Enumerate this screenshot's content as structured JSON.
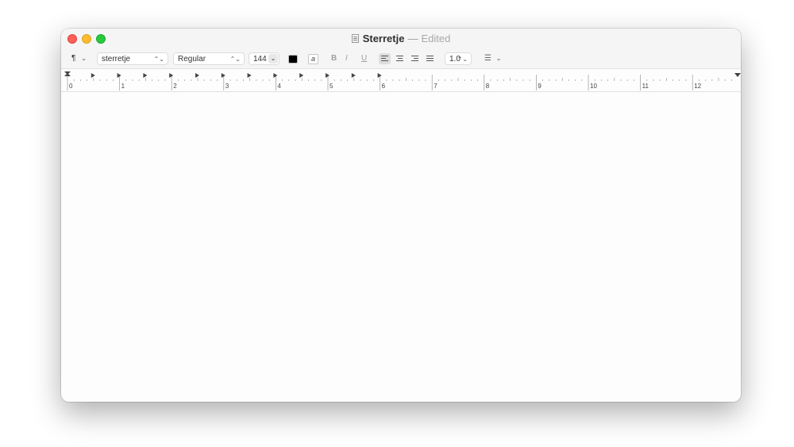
{
  "window": {
    "title_name": "Sterretje",
    "title_separator": "—",
    "title_status": "Edited"
  },
  "toolbar": {
    "paragraph_symbol": "¶",
    "paragraph_chevron": "⌄",
    "font_family": "sterretje",
    "font_style": "Regular",
    "font_size": "144",
    "size_chevron": "⌄",
    "bold_label": "B",
    "italic_label": "I",
    "underline_label": "U",
    "line_spacing": "1.0",
    "list_icon": "☰",
    "list_chevron": "⌄",
    "popup_arrows": "⌃⌄",
    "text_color": "#000000"
  },
  "ruler": {
    "labels": [
      "0",
      "1",
      "2",
      "3",
      "4",
      "5",
      "6",
      "7",
      "8",
      "9",
      "10",
      "11",
      "12"
    ]
  },
  "document": {
    "body_text": ""
  }
}
